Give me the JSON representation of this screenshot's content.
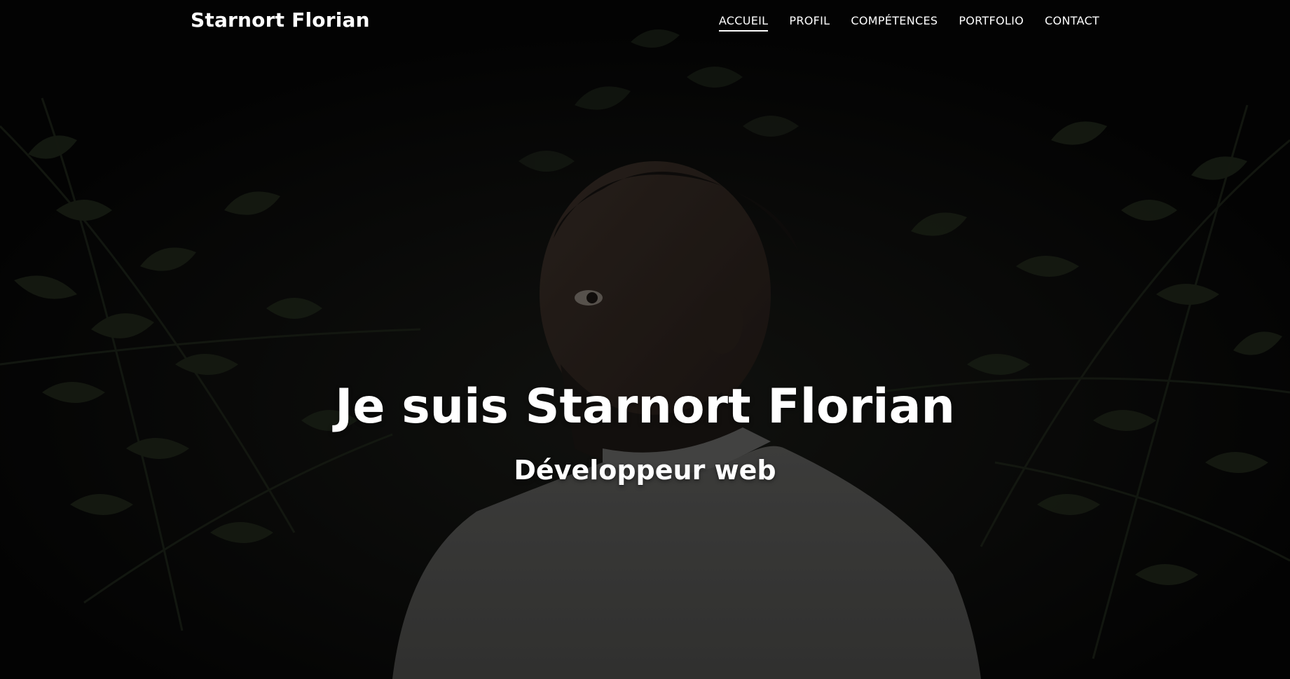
{
  "brand": "Starnort Florian",
  "nav": {
    "items": [
      {
        "label": "ACCUEIL",
        "active": true
      },
      {
        "label": "PROFIL",
        "active": false
      },
      {
        "label": "COMPÉTENCES",
        "active": false
      },
      {
        "label": "PORTFOLIO",
        "active": false
      },
      {
        "label": "CONTACT",
        "active": false
      }
    ]
  },
  "hero": {
    "title": "Je suis Starnort Florian",
    "subtitle": "Développeur web"
  },
  "colors": {
    "text": "#ffffff",
    "overlay": "#070707",
    "foliage": "#2a3322",
    "shirt": "#5a5a58",
    "skin": "#3a2e27"
  }
}
